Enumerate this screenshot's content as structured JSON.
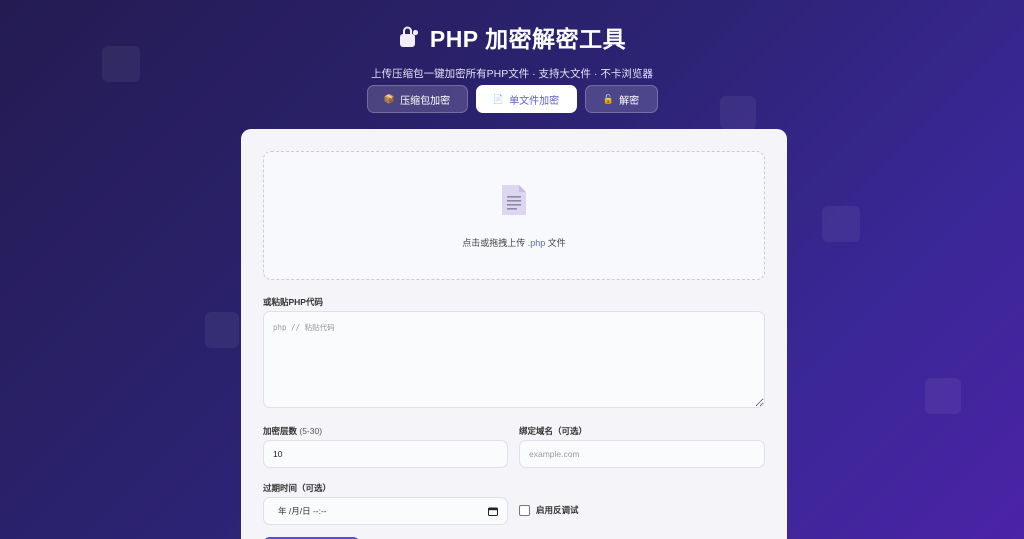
{
  "header": {
    "title": "PHP 加密解密工具",
    "subtitle": "上传压缩包一键加密所有PHP文件 · 支持大文件 · 不卡浏览器",
    "icon": "lock-bag-icon"
  },
  "tabs": [
    {
      "label": "压缩包加密",
      "icon": "package-icon",
      "glyph": "📦",
      "active": false
    },
    {
      "label": "单文件加密",
      "icon": "document-icon",
      "glyph": "📄",
      "active": true
    },
    {
      "label": "解密",
      "icon": "unlock-icon",
      "glyph": "🔓",
      "active": false
    }
  ],
  "upload": {
    "text_prefix": "点击或拖拽上传 ",
    "extension": ".php",
    "text_suffix": " 文件"
  },
  "paste": {
    "label": "或粘贴PHP代码",
    "placeholder": "php // 粘贴代码"
  },
  "layers": {
    "label": "加密层数",
    "hint": " (5-30)",
    "value": "10"
  },
  "domain": {
    "label": "绑定域名（可选）",
    "placeholder": "example.com"
  },
  "expiry": {
    "label": "过期时间（可选）",
    "placeholder": "年 /月/日 --:--"
  },
  "anti_debug": {
    "label": "启用反调试",
    "checked": false
  },
  "colors": {
    "accent": "#5a63d8",
    "background_start": "#241b52",
    "background_end": "#4b23a6"
  }
}
